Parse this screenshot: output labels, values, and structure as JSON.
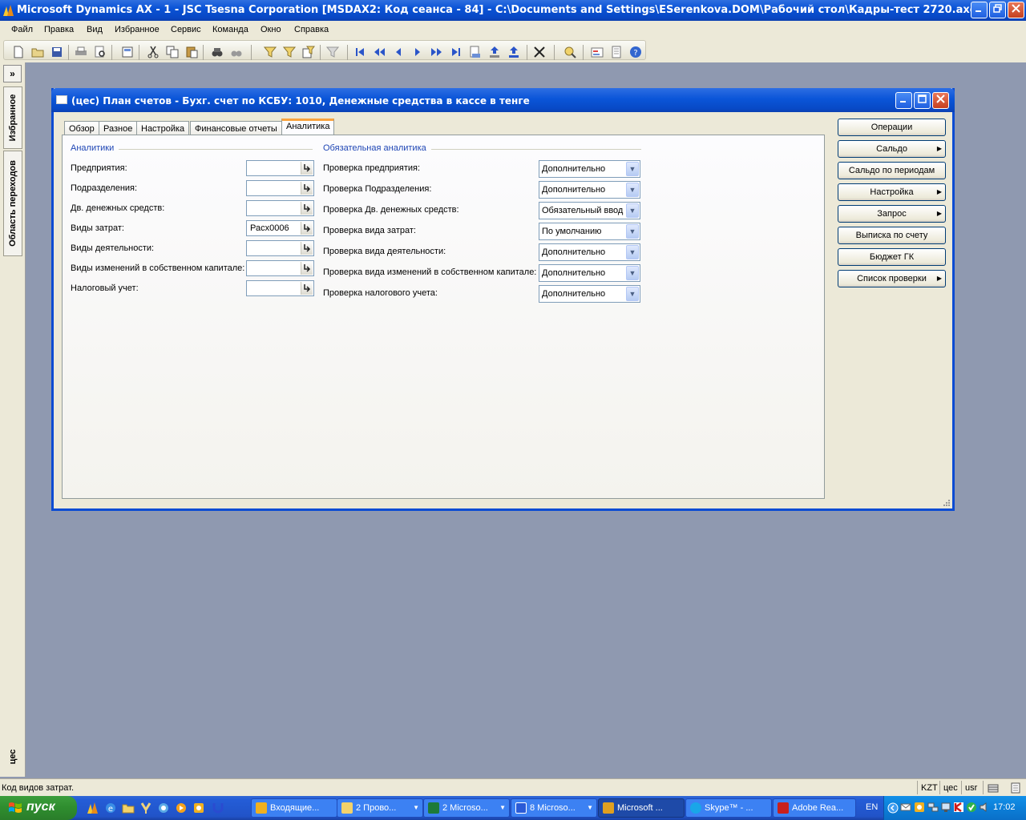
{
  "window": {
    "title": "Microsoft Dynamics AX - 1 - JSC Tsesna Corporation [MSDAX2: Код сеанса - 84] - C:\\Documents and Settings\\ESerenkova.DOM\\Рабочий стол\\Кадры-тест 2720.axc"
  },
  "menu": {
    "items": [
      "Файл",
      "Правка",
      "Вид",
      "Избранное",
      "Сервис",
      "Команда",
      "Окно",
      "Справка"
    ]
  },
  "toolbar": {
    "icons": [
      "new-icon",
      "open-icon",
      "save-icon",
      "print-icon",
      "print-preview-icon",
      "form-icon",
      "cut-icon",
      "copy-icon",
      "paste-icon",
      "find-icon",
      "find-next-icon",
      "filter-by-selection-icon",
      "filter-by-grid-icon",
      "advanced-filter-icon",
      "remove-filter-icon",
      "first-record-icon",
      "previous-page-icon",
      "previous-record-icon",
      "next-record-icon",
      "next-page-icon",
      "last-record-icon",
      "insert-record-icon",
      "export-icon",
      "delete-icon",
      "lookup-icon",
      "report-icon",
      "document-icon",
      "help-icon"
    ]
  },
  "sidepane": {
    "favorites": "Избранное",
    "navigation": "Область переходов",
    "company": "цес"
  },
  "form": {
    "title": "(цес) План счетов - Бухг. счет по КСБУ: 1010, Денежные средства в кассе в тенге",
    "tabs": [
      "Обзор",
      "Разное",
      "Настройка",
      "Финансовые отчеты",
      "Аналитика"
    ],
    "active_tab": "Аналитика",
    "analytics": {
      "title": "Аналитики",
      "fields": [
        {
          "label": "Предприятия:",
          "value": ""
        },
        {
          "label": "Подразделения:",
          "value": ""
        },
        {
          "label": "Дв. денежных средств:",
          "value": ""
        },
        {
          "label": "Виды затрат:",
          "value": "Расх0006"
        },
        {
          "label": "Виды деятельности:",
          "value": ""
        },
        {
          "label": "Виды изменений в собственном капитале:",
          "value": ""
        },
        {
          "label": "Налоговый учет:",
          "value": ""
        }
      ]
    },
    "mandatory": {
      "title": "Обязательная аналитика",
      "fields": [
        {
          "label": "Проверка предприятия:",
          "value": "Дополнительно"
        },
        {
          "label": "Проверка Подразделения:",
          "value": "Дополнительно"
        },
        {
          "label": "Проверка Дв. денежных средств:",
          "value": "Обязательный ввод"
        },
        {
          "label": "Проверка вида затрат:",
          "value": "По умолчанию"
        },
        {
          "label": "Проверка вида деятельности:",
          "value": "Дополнительно"
        },
        {
          "label": "Проверка вида изменений в собственном капитале:",
          "value": "Дополнительно"
        },
        {
          "label": "Проверка налогового учета:",
          "value": "Дополнительно"
        }
      ]
    },
    "buttons": [
      {
        "label": "Операции",
        "submenu": false
      },
      {
        "label": "Сальдо",
        "submenu": true
      },
      {
        "label": "Сальдо по периодам",
        "submenu": false
      },
      {
        "label": "Настройка",
        "submenu": true
      },
      {
        "label": "Запрос",
        "submenu": true
      },
      {
        "label": "Выписка по счету",
        "submenu": false
      },
      {
        "label": "Бюджет ГК",
        "submenu": false
      },
      {
        "label": "Список проверки",
        "submenu": true
      }
    ]
  },
  "status": {
    "help_text": "Код видов затрат.",
    "currency": "KZT",
    "company": "цес",
    "layer": "usr"
  },
  "taskbar": {
    "start_label": "пуск",
    "tasks": [
      {
        "label": "Входящие...",
        "icon": "outlook-icon",
        "color": "#f0b020"
      },
      {
        "label": "2 Прово...",
        "icon": "folder-icon",
        "color": "#f3d26b"
      },
      {
        "label": "2 Microso...",
        "icon": "excel-icon",
        "color": "#1d7a3a"
      },
      {
        "label": "8 Microso...",
        "icon": "word-icon",
        "color": "#2a5bd7"
      },
      {
        "label": "Microsoft ...",
        "icon": "dynamics-ax-icon",
        "color": "#e0a020"
      },
      {
        "label": "Skype™ - ...",
        "icon": "skype-icon",
        "color": "#19a6e8"
      },
      {
        "label": "Adobe Rea...",
        "icon": "adobe-reader-icon",
        "color": "#c8201c"
      }
    ],
    "language": "EN",
    "clock": "17:02"
  }
}
